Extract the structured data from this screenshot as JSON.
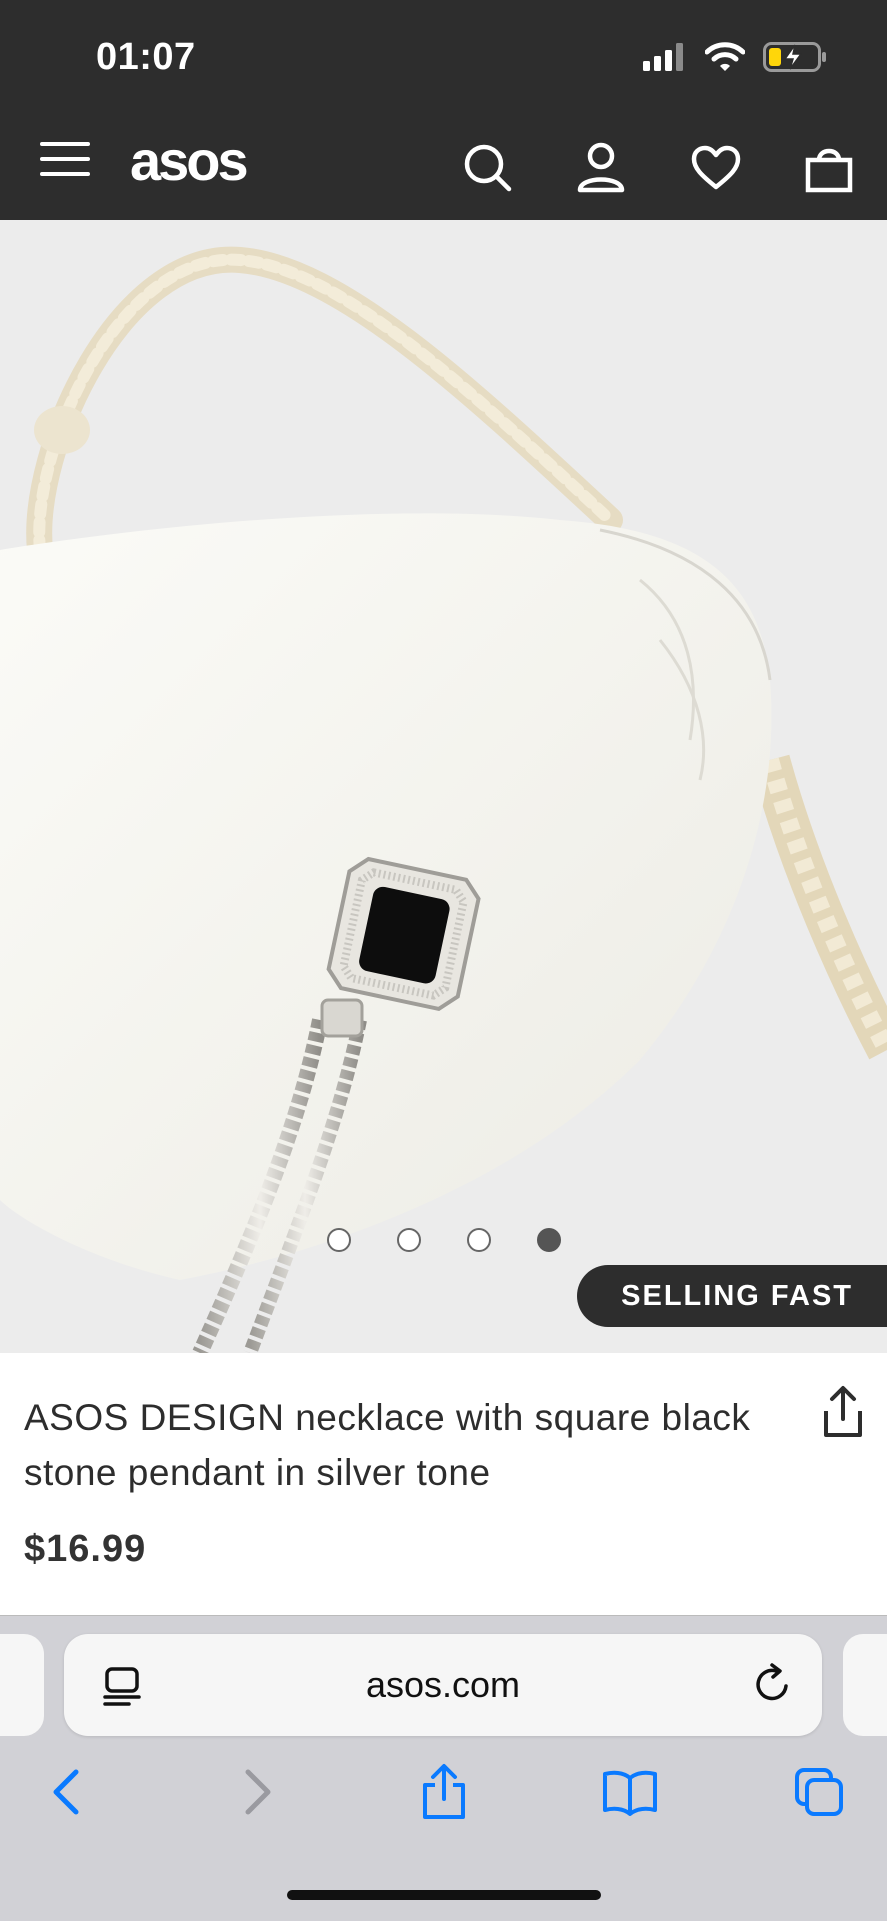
{
  "status_bar": {
    "time": "01:07"
  },
  "header": {
    "logo": "asos"
  },
  "carousel": {
    "slide_count": 4,
    "active_index": 3
  },
  "product": {
    "badge": "SELLING FAST",
    "title": "ASOS DESIGN necklace with square black stone pendant in silver tone",
    "price": "$16.99"
  },
  "browser": {
    "url": "asos.com"
  },
  "colors": {
    "header_bg": "#2d2d2d",
    "ios_blue": "#0a7aff",
    "text_dark": "#2d2d2d",
    "battery_yellow": "#ffd60a"
  },
  "icons": [
    "menu-icon",
    "search-icon",
    "account-icon",
    "heart-icon",
    "bag-icon",
    "share-icon",
    "reader-icon",
    "reload-icon",
    "back-icon",
    "forward-icon",
    "safari-share-icon",
    "bookmarks-icon",
    "tabs-icon"
  ]
}
